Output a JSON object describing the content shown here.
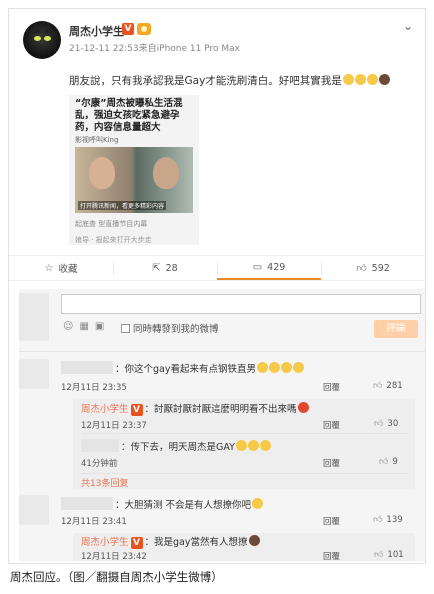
{
  "post": {
    "username": "周杰小学生",
    "v_badge": "V",
    "meta": "21-12-11 22:53来自iPhone 11 Pro Max",
    "text": "朋友說，只有我承認我是Gay才能洗刷清白。好吧其實我是",
    "image": {
      "headline": "“尔康”周杰被曝私生活混乱，强迫女孩吃紧急避孕药，内容信息量超大",
      "source": "影视呼叫King",
      "caption": "打开腾讯新闻，看更多精彩内容",
      "sub": "起底查 型直播节目内幕",
      "cut": "娘导 · 报起来打开大步走"
    }
  },
  "actions": {
    "favorite": "收藏",
    "repost": "28",
    "comment": "429",
    "like": "592"
  },
  "composer": {
    "also_post": "同時轉發到我的微博",
    "submit": "評論"
  },
  "comments": [
    {
      "text": "：你这个gay看起来有点钢铁直男",
      "time": "12月11日 23:35",
      "reply": "回覆",
      "likes": "281"
    },
    {
      "name": "周杰小学生",
      "text": "：討厭討厭討厭這麼明明看不出來嗎",
      "time": "12月11日 23:37",
      "reply": "回覆",
      "likes": "30"
    },
    {
      "text": "：传下去，明天周杰是GAY",
      "time": "41分钟前",
      "reply": "回覆",
      "likes": "9"
    },
    {
      "text": "：大胆猜测  不会是有人想撩你吧",
      "time": "12月11日 23:41",
      "reply": "回覆",
      "likes": "139"
    },
    {
      "name": "周杰小学生",
      "text": "：我是gay當然有人想撩",
      "time": "12月11日 23:42",
      "reply": "回覆",
      "likes": "101"
    }
  ],
  "more_replies": "共13条回复",
  "caption": "周杰回应。（图／翻摄自周杰小学生微博）",
  "colors": {
    "accent": "#eb7350",
    "submit_disabled": "#ffd0a8",
    "v_badge": "#e8531f"
  }
}
